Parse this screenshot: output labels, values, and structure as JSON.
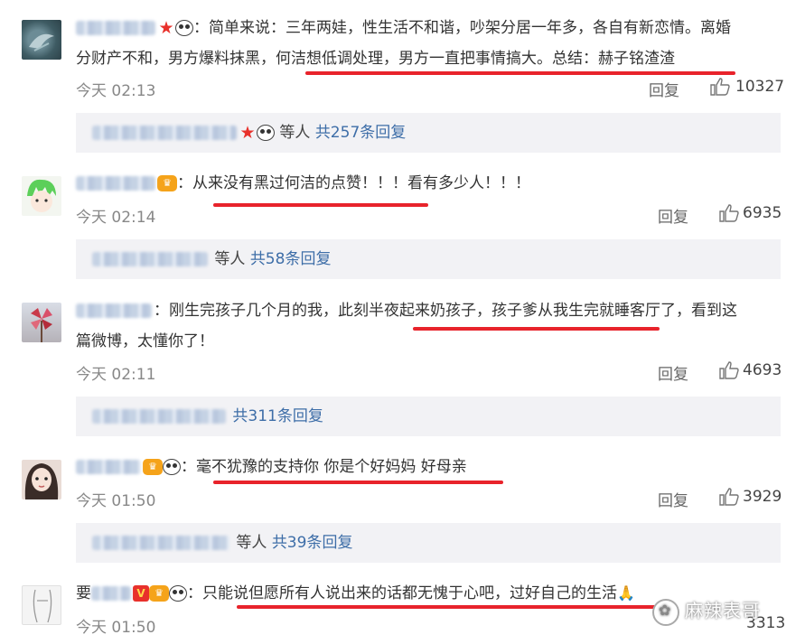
{
  "comments": [
    {
      "text1": "：简单来说：三年两娃，性生活不和谐，吵架分居一年多，各自有新恋情。离婚",
      "text2": "分财产不和，男方爆料抹黑，何洁想低调处理，男方一直把事情搞大。总结：赫子铭渣渣",
      "time": "今天 02:13",
      "reply": "回复",
      "likes": "10327",
      "thread_suffix": "等人",
      "thread_count": "共257条回复",
      "avatar_icon": "bird-avatar-icon"
    },
    {
      "text1": "：从来没有黑过何洁的点赞！！！看有多少人！！！",
      "time": "今天 02:14",
      "reply": "回复",
      "likes": "6935",
      "thread_suffix": "等人",
      "thread_count": "共58条回复",
      "avatar_icon": "anime-boy-avatar-icon"
    },
    {
      "text1": "：刚生完孩子几个月的我，此刻半夜起来奶孩子，孩子爹从我生完就睡客厅了，看到这",
      "text2": "篇微博，太懂你了！",
      "time": "今天 02:11",
      "reply": "回复",
      "likes": "4693",
      "thread_suffix": "",
      "thread_count": "共311条回复",
      "avatar_icon": "pinwheel-avatar-icon"
    },
    {
      "text1": "：毫不犹豫的支持你 你是个好妈妈 好母亲",
      "time": "今天 01:50",
      "reply": "回复",
      "likes": "3929",
      "thread_suffix": "等人",
      "thread_count": "共39条回复",
      "avatar_icon": "girl-avatar-icon"
    },
    {
      "name_prefix": "要",
      "text1": "：只能说但愿所有人说出来的话都无愧于心吧，过好自己的生活",
      "time": "今天 01:50",
      "reply": "回复",
      "likes": "3313",
      "avatar_icon": "sketch-avatar-icon"
    }
  ],
  "watermark": "麻辣表哥",
  "colors": {
    "link": "#3e6ea8",
    "highlight": "#e8232b",
    "thread_bg": "#f2f2f5"
  }
}
